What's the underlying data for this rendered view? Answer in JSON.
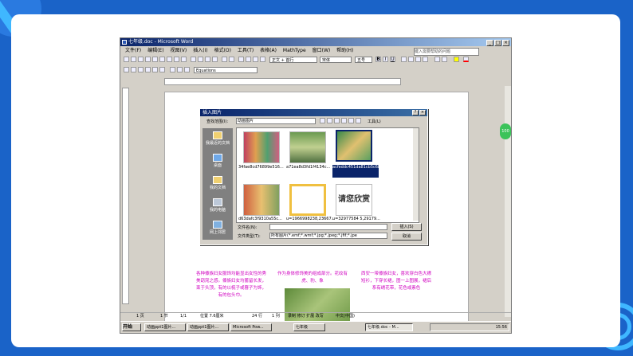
{
  "window": {
    "title": "七年级.doc - Microsoft Word",
    "menus": [
      "文件(F)",
      "编辑(E)",
      "视图(V)",
      "插入(I)",
      "格式(O)",
      "工具(T)",
      "表格(A)",
      "MathType",
      "窗口(W)",
      "帮助(H)"
    ],
    "help_placeholder": "键入需要帮助的问题"
  },
  "toolbar": {
    "style_value": "正文 + 首行",
    "font_value": "宋体",
    "size_value": "五号",
    "equation_value": "Equations",
    "bold": "B",
    "italic": "I",
    "underline": "U"
  },
  "dialog": {
    "title": "插入图片",
    "lookin_label": "查找范围(I):",
    "lookin_value": "动画图片",
    "tools_label": "工具(L)",
    "places": [
      "我最近的文档",
      "桌面",
      "我的文档",
      "我的电脑",
      "网上邻居"
    ],
    "files": [
      "34fae8cd76899e516...",
      "a71ea8d3fd1f4134c...",
      "acfeddc451da81cb5c6b37f2510e4016b2fb81c6.gif",
      "d63dafc3f9310a55c...",
      "u=1966998238,23667...",
      "u=32977584 5,29179..."
    ],
    "thumb_text": "请您欣赏",
    "filename_label": "文件名(N):",
    "filename_value": "",
    "filetype_label": "文件类型(T):",
    "filetype_value": "所有图片(*.emf;*.wmf;*.jpg;*.jpeg;*.jfif;*.jpe",
    "insert_button": "插入(S)",
    "cancel_button": "取消"
  },
  "document": {
    "col1": "各种傣族妇女服饰均能显出女性的秀美窈窕之感。傣族妇女均蓄留长发，束于头顶，有的以梳子或簪子为饰，有的包头巾。",
    "col2": "作为身体修饰美的组成部分。花纹有虎、豹、象",
    "col3": "西安一带傣族妇女，喜欢穿白色大襟短衫，下穿长裙，图一上图展，裙后系有绣花带，花色或素色"
  },
  "statusbar": {
    "page": "1 页",
    "section": "1 节",
    "pos": "1/1",
    "at": "位置 7.6厘米",
    "line": "24 行",
    "col": "1 列",
    "modes": "录制 修订 扩展 改写",
    "lang": "中文(中国)"
  },
  "taskbar": {
    "start": "开始",
    "tasks": [
      "动画ppt1图片...",
      "动画ppt1图片...",
      "Microsoft Pow...",
      "七年级"
    ],
    "active": "七年级.doc - M...",
    "clock": "15:56"
  },
  "bubble": "100"
}
